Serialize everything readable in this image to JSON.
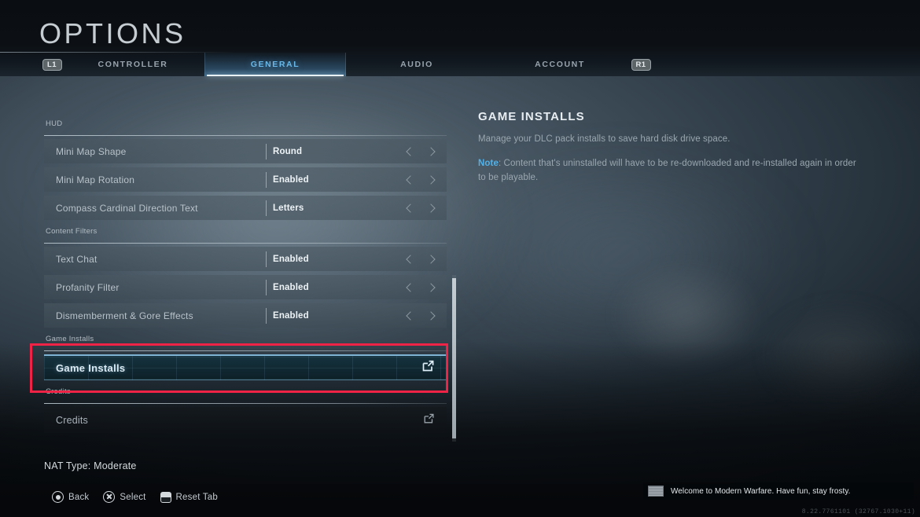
{
  "header": {
    "title": "OPTIONS",
    "left_bumper": "L1",
    "right_bumper": "R1",
    "tabs": [
      {
        "label": "CONTROLLER",
        "active": false
      },
      {
        "label": "GENERAL",
        "active": true
      },
      {
        "label": "AUDIO",
        "active": false
      },
      {
        "label": "ACCOUNT",
        "active": false
      }
    ]
  },
  "settings": {
    "sections": [
      {
        "heading": "HUD",
        "rows": [
          {
            "type": "option",
            "label": "Mini Map Shape",
            "value": "Round",
            "prev_icon": "chevron-left-icon",
            "next_icon": "chevron-right-icon"
          },
          {
            "type": "option",
            "label": "Mini Map Rotation",
            "value": "Enabled",
            "prev_icon": "chevron-left-icon",
            "next_icon": "chevron-right-icon"
          },
          {
            "type": "option",
            "label": "Compass Cardinal Direction Text",
            "value": "Letters",
            "prev_icon": "chevron-left-icon",
            "next_icon": "chevron-right-icon"
          }
        ]
      },
      {
        "heading": "Content Filters",
        "rows": [
          {
            "type": "option",
            "label": "Text Chat",
            "value": "Enabled",
            "prev_icon": "chevron-left-icon",
            "next_icon": "chevron-right-icon"
          },
          {
            "type": "option",
            "label": "Profanity Filter",
            "value": "Enabled",
            "prev_icon": "chevron-left-icon",
            "next_icon": "chevron-right-icon"
          },
          {
            "type": "option",
            "label": "Dismemberment & Gore Effects",
            "value": "Enabled",
            "prev_icon": "chevron-left-icon",
            "next_icon": "chevron-right-icon"
          }
        ]
      },
      {
        "heading": "Game Installs",
        "rows": [
          {
            "type": "link",
            "label": "Game Installs",
            "selected": true,
            "icon": "external-link-icon"
          }
        ]
      },
      {
        "heading": "Credits",
        "rows": [
          {
            "type": "link",
            "label": "Credits",
            "selected": false,
            "icon": "external-link-icon"
          }
        ]
      }
    ]
  },
  "info_panel": {
    "title": "GAME INSTALLS",
    "description": "Manage your DLC pack installs to save hard disk drive space.",
    "note_label": "Note",
    "note_text": ": Content that's uninstalled will have to be re-downloaded and re-installed again in order to be playable."
  },
  "status": {
    "nat_type": "NAT Type: Moderate"
  },
  "footer": {
    "prompts": [
      {
        "label": "Back",
        "icon": "circle-button-icon"
      },
      {
        "label": "Select",
        "icon": "cross-button-icon"
      },
      {
        "label": "Reset Tab",
        "icon": "touchpad-button-icon"
      }
    ]
  },
  "toast": {
    "message": "Welcome to Modern Warfare. Have fun, stay frosty."
  },
  "build_string": "8.22.7761101 (32767.1030+11)",
  "colors": {
    "accent_blue": "#69b8e8",
    "note_blue": "#4fb2ea",
    "annotation_red": "#ef2346",
    "selected_row_bg": "#112933"
  }
}
